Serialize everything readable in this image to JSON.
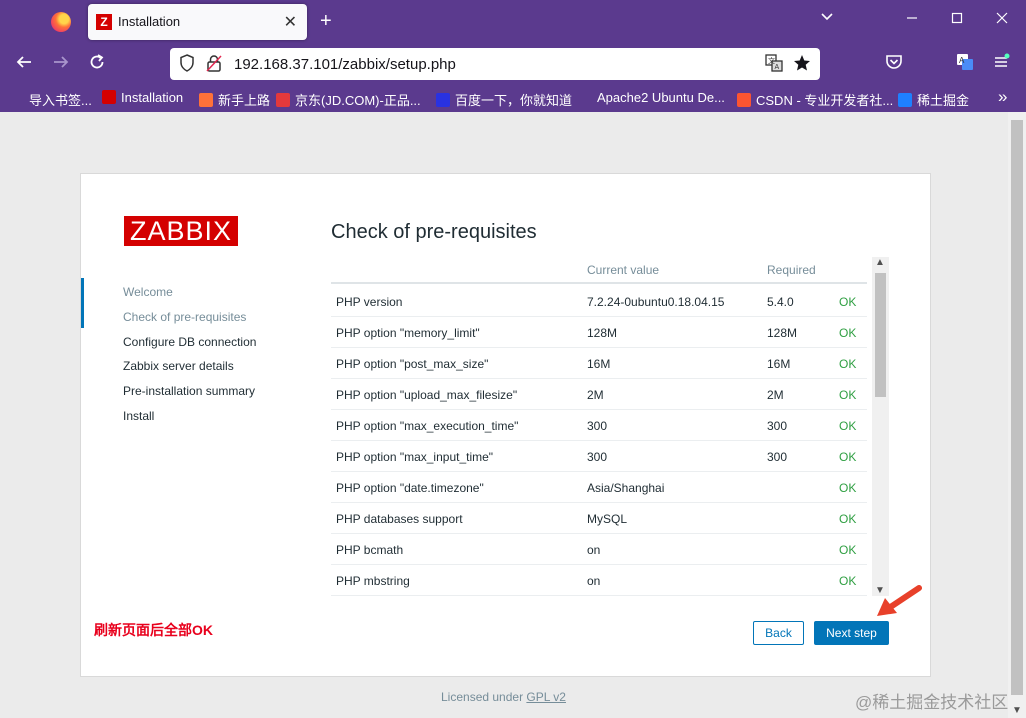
{
  "browser": {
    "tab_title": "Installation",
    "tab_favicon": "Z",
    "tab_close": "✕",
    "new_tab": "+",
    "url": "192.168.37.101/zabbix/setup.php",
    "bookmarks": [
      {
        "label": "导入书签...",
        "icon": "import-icon",
        "color": "#5b3a8e"
      },
      {
        "label": "Installation",
        "icon": "Z",
        "color": "#d40000"
      },
      {
        "label": "新手上路",
        "icon": "firefox-icon",
        "color": "#ff7139"
      },
      {
        "label": "京东(JD.COM)-正品...",
        "icon": "JD",
        "color": "#e4393c"
      },
      {
        "label": "百度一下，你就知道",
        "icon": "baidu-icon",
        "color": "#2932e1"
      },
      {
        "label": "Apache2 Ubuntu De...",
        "icon": "globe-icon",
        "color": "#5b3a8e"
      },
      {
        "label": "CSDN - 专业开发者社...",
        "icon": "C",
        "color": "#fc5531"
      },
      {
        "label": "稀土掘金",
        "icon": "juejin-icon",
        "color": "#1e80ff"
      }
    ],
    "overflow": "»"
  },
  "app": {
    "logo": "ZABBIX",
    "steps": [
      {
        "label": "Welcome",
        "state": "done"
      },
      {
        "label": "Check of pre-requisites",
        "state": "current"
      },
      {
        "label": "Configure DB connection",
        "state": "todo"
      },
      {
        "label": "Zabbix server details",
        "state": "todo"
      },
      {
        "label": "Pre-installation summary",
        "state": "todo"
      },
      {
        "label": "Install",
        "state": "todo"
      }
    ],
    "heading": "Check of pre-requisites",
    "columns": {
      "current": "Current value",
      "required": "Required"
    },
    "rows": [
      {
        "name": "PHP version",
        "current": "7.2.24-0ubuntu0.18.04.15",
        "required": "5.4.0",
        "status": "OK"
      },
      {
        "name": "PHP option \"memory_limit\"",
        "current": "128M",
        "required": "128M",
        "status": "OK"
      },
      {
        "name": "PHP option \"post_max_size\"",
        "current": "16M",
        "required": "16M",
        "status": "OK"
      },
      {
        "name": "PHP option \"upload_max_filesize\"",
        "current": "2M",
        "required": "2M",
        "status": "OK"
      },
      {
        "name": "PHP option \"max_execution_time\"",
        "current": "300",
        "required": "300",
        "status": "OK"
      },
      {
        "name": "PHP option \"max_input_time\"",
        "current": "300",
        "required": "300",
        "status": "OK"
      },
      {
        "name": "PHP option \"date.timezone\"",
        "current": "Asia/Shanghai",
        "required": "",
        "status": "OK"
      },
      {
        "name": "PHP databases support",
        "current": "MySQL",
        "required": "",
        "status": "OK"
      },
      {
        "name": "PHP bcmath",
        "current": "on",
        "required": "",
        "status": "OK"
      },
      {
        "name": "PHP mbstring",
        "current": "on",
        "required": "",
        "status": "OK"
      }
    ],
    "annotation": "刷新页面后全部OK",
    "back_label": "Back",
    "next_label": "Next step",
    "footer_prefix": "Licensed under",
    "footer_link": "GPL v2"
  },
  "watermark": "@稀土掘金技术社区",
  "colors": {
    "chrome": "#5b3a8e",
    "zabbix_red": "#d40000",
    "accent": "#0275b8",
    "ok": "#2f9f42",
    "annotation": "#e8001c"
  }
}
